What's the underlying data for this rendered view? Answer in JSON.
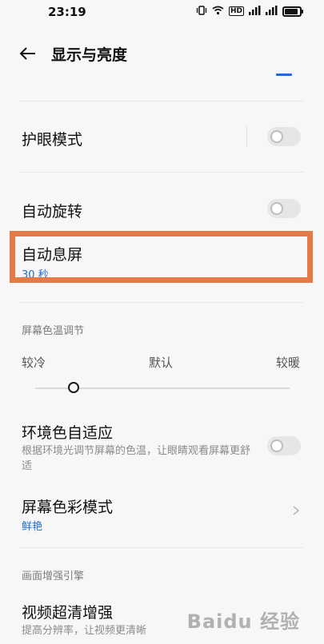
{
  "status_bar": {
    "time": "23:19",
    "icons": [
      "vibrate-icon",
      "wifi-icon",
      "hd-icon",
      "signal-4g-icon",
      "signal-4g-icon-2",
      "battery-icon"
    ]
  },
  "header": {
    "title": "显示与亮度",
    "back_icon": "arrow-left-icon"
  },
  "settings": {
    "eye_protection": {
      "label": "护眼模式",
      "enabled": false
    },
    "auto_rotate": {
      "label": "自动旋转",
      "enabled": false
    },
    "auto_screen_off": {
      "label": "自动息屏",
      "value": "30 秒"
    },
    "color_temperature": {
      "section_title": "屏幕色温调节",
      "options": [
        "较冷",
        "默认",
        "较暖"
      ],
      "level": 0.15
    },
    "ambient_adaptive": {
      "label": "环境色自适应",
      "description": "根据环境光调节屏幕的色温，让眼睛观看屏幕更舒适",
      "enabled": false
    },
    "color_mode": {
      "label": "屏幕色彩模式",
      "value": "鲜艳"
    },
    "enhancement_section": "画面增强引擎",
    "video_enhance": {
      "label": "视频超清增强",
      "description": "提高分辨率，让视频更清晰"
    }
  },
  "watermark": "Baidu 经验",
  "colors": {
    "accent": "#1f6bd6",
    "highlight": "#e47a46"
  }
}
